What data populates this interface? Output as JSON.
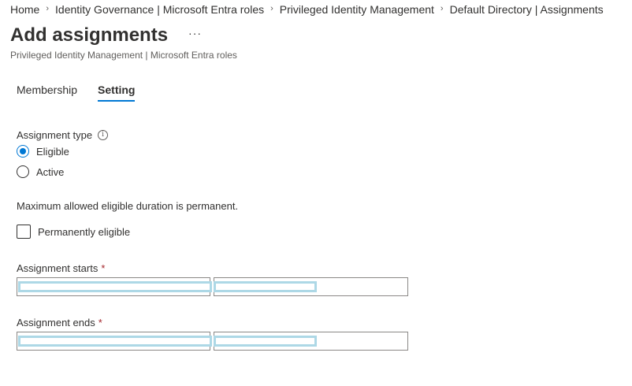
{
  "breadcrumb": {
    "items": [
      "Home",
      "Identity Governance | Microsoft Entra roles",
      "Privileged Identity Management",
      "Default Directory | Assignments"
    ],
    "separator": "›"
  },
  "header": {
    "title": "Add assignments",
    "more_label": "···",
    "subtitle": "Privileged Identity Management | Microsoft Entra roles"
  },
  "tabs": [
    {
      "label": "Membership",
      "active": false
    },
    {
      "label": "Setting",
      "active": true
    }
  ],
  "assignment_type": {
    "label": "Assignment type",
    "info_glyph": "i",
    "options": [
      {
        "label": "Eligible",
        "checked": true
      },
      {
        "label": "Active",
        "checked": false
      }
    ]
  },
  "duration_message": "Maximum allowed eligible duration is permanent.",
  "permanently_eligible": {
    "label": "Permanently eligible",
    "checked": false
  },
  "assignment_starts": {
    "label": "Assignment starts",
    "required_mark": "*",
    "date_value": "",
    "time_value": ""
  },
  "assignment_ends": {
    "label": "Assignment ends",
    "required_mark": "*",
    "date_value": "",
    "time_value": ""
  },
  "colors": {
    "accent": "#0078d4",
    "required": "#a4262c",
    "redaction": "#add8e6"
  }
}
